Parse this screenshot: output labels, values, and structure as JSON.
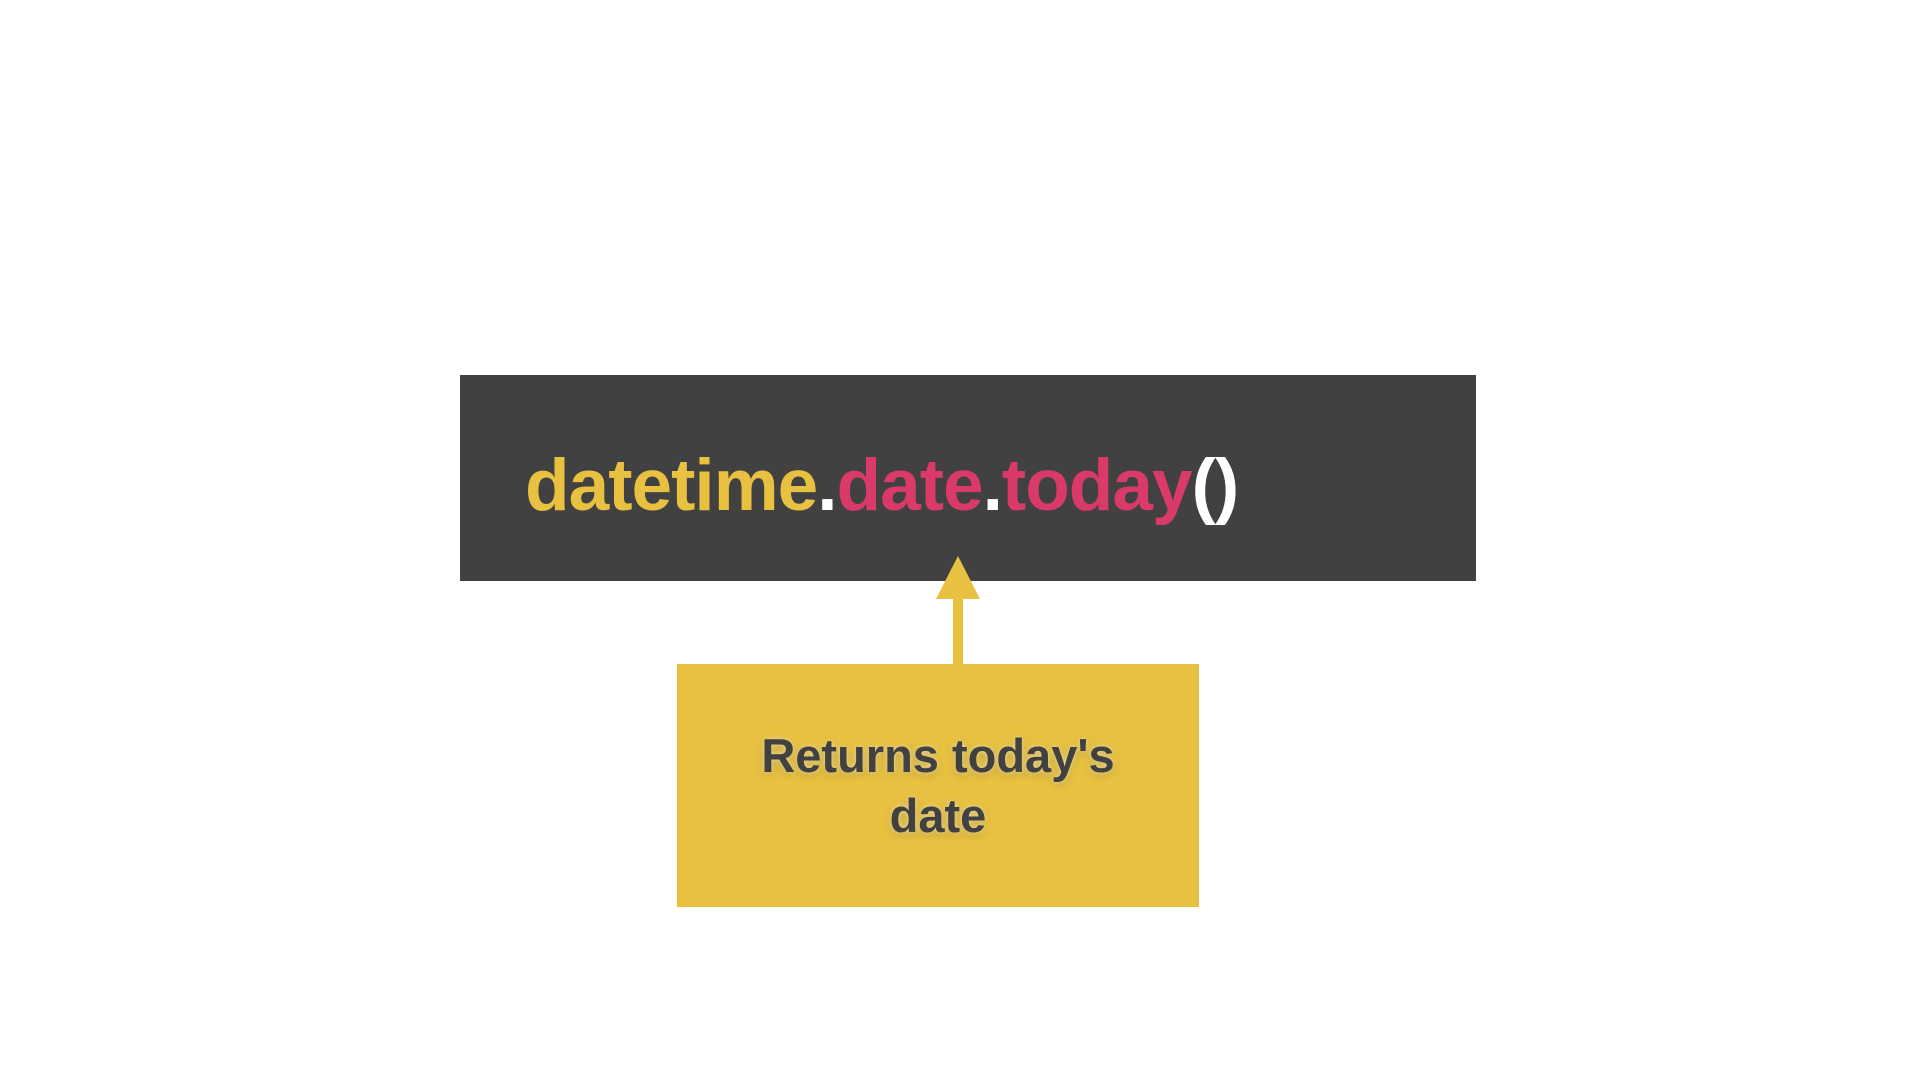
{
  "code": {
    "tokens": [
      {
        "text": "datetime",
        "color": "#e8c141"
      },
      {
        "text": ".",
        "color": "#ffffff"
      },
      {
        "text": "date",
        "color": "#d93a68"
      },
      {
        "text": ".",
        "color": "#ffffff"
      },
      {
        "text": "today",
        "color": "#d93a68"
      },
      {
        "text": "()",
        "color": "#ffffff"
      }
    ],
    "background": "#414141"
  },
  "annotation": {
    "text": "Returns today's date",
    "background": "#e8c141",
    "text_color": "#414141",
    "arrow_color": "#e8c141",
    "arrow_direction": "up"
  }
}
